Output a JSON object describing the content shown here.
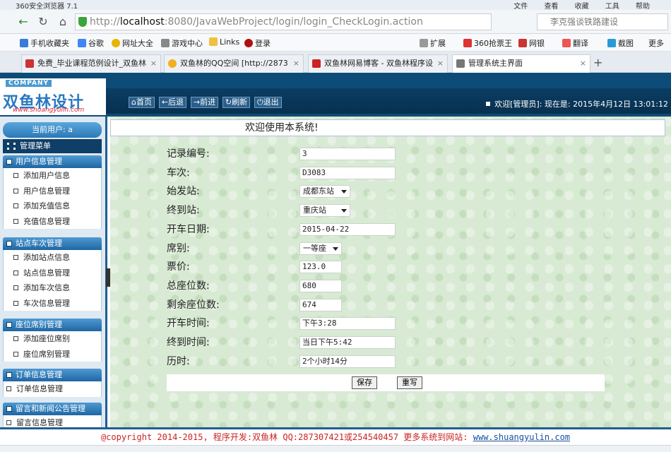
{
  "browser": {
    "title": "360安全浏览器 7.1",
    "menu": [
      "文件",
      "查看",
      "收藏",
      "工具",
      "帮助"
    ],
    "address": {
      "scheme": "http://",
      "host": "localhost",
      "rest": ":8080/JavaWebProject/login/login_CheckLogin.action"
    },
    "search_placeholder": "李克强谈铁路建设",
    "bookmarks": [
      "手机收藏夹",
      "谷歌",
      "网址大全",
      "游戏中心",
      "Links",
      "登录",
      "扩展",
      "360抢票王",
      "网银",
      "翻译",
      "截图",
      "更多"
    ],
    "tabs": [
      {
        "label": "免费_毕业课程范例设计_双鱼林",
        "active": false
      },
      {
        "label": "双鱼林的QQ空间 [http://2873",
        "active": false
      },
      {
        "label": "双鱼林网易博客 - 双鱼林程序设",
        "active": false
      },
      {
        "label": "管理系统主界面",
        "active": true
      }
    ]
  },
  "header": {
    "company": "COMPANY",
    "brand": "双鱼林设计",
    "url": "www.shuangyulin.com",
    "nav": [
      "首页",
      "后退",
      "前进",
      "刷新",
      "退出"
    ],
    "welcome": "欢迎[管理员]:  现在是: 2015年4月12日 13:01:12"
  },
  "sidebar": {
    "current_user": "当前用户: a",
    "manage_menu": "管理菜单",
    "groups": [
      {
        "title": "用户信息管理",
        "items": [
          "添加用户信息",
          "用户信息管理",
          "添加充值信息",
          "充值信息管理"
        ]
      },
      {
        "title": "站点车次管理",
        "items": [
          "添加站点信息",
          "站点信息管理",
          "添加车次信息",
          "车次信息管理"
        ]
      },
      {
        "title": "座位席别管理",
        "items": [
          "添加座位席别",
          "座位席别管理"
        ]
      },
      {
        "title": "订单信息管理",
        "items": [
          "订单信息管理"
        ]
      },
      {
        "title": "留言和新闻公告管理",
        "items": [
          "留言信息管理"
        ]
      }
    ]
  },
  "main": {
    "title": "欢迎使用本系统!",
    "fields": [
      {
        "label": "记录编号:",
        "value": "3",
        "kind": "input",
        "w": 136
      },
      {
        "label": "车次:",
        "value": "D3083",
        "kind": "input",
        "w": 136
      },
      {
        "label": "始发站:",
        "value": "成都东站",
        "kind": "select",
        "w": 72
      },
      {
        "label": "终到站:",
        "value": "重庆站",
        "kind": "select",
        "w": 72
      },
      {
        "label": "开车日期:",
        "value": "2015-04-22",
        "kind": "input",
        "w": 136
      },
      {
        "label": "席别:",
        "value": "一等座",
        "kind": "select",
        "w": 60
      },
      {
        "label": "票价:",
        "value": "123.0",
        "kind": "input",
        "w": 60
      },
      {
        "label": "总座位数:",
        "value": "680",
        "kind": "input",
        "w": 60
      },
      {
        "label": "剩余座位数:",
        "value": "674",
        "kind": "input",
        "w": 60
      },
      {
        "label": "开车时间:",
        "value": "下午3:28",
        "kind": "input",
        "w": 136
      },
      {
        "label": "终到时间:",
        "value": "当日下午5:42",
        "kind": "input",
        "w": 136
      },
      {
        "label": "历时:",
        "value": "2个小时14分",
        "kind": "input",
        "w": 136
      }
    ],
    "save_label": "保存",
    "reset_label": "重写"
  },
  "footer": {
    "text": "@copyright 2014-2015, 程序开发:双鱼林  QQ:287307421或254540457  更多系统到网站: ",
    "link": "www.shuangyulin.com"
  }
}
